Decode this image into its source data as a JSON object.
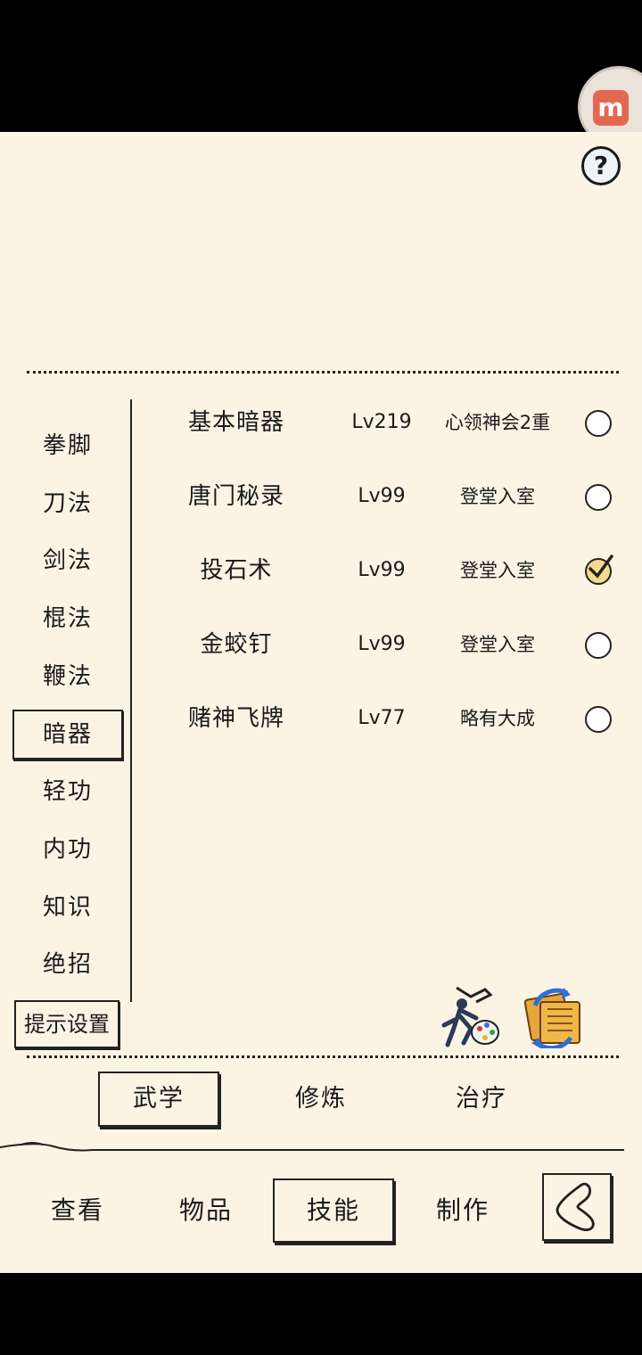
{
  "help": {
    "label": "?"
  },
  "app_badge": {
    "label": "m"
  },
  "categories": [
    "拳脚",
    "刀法",
    "剑法",
    "棍法",
    "鞭法",
    "暗器",
    "轻功",
    "内功",
    "知识",
    "绝招"
  ],
  "active_category": "暗器",
  "hint_settings_label": "提示设置",
  "skills": [
    {
      "name": "基本暗器",
      "level": "Lv219",
      "stage": "心领神会2重",
      "checked": false
    },
    {
      "name": "唐门秘录",
      "level": "Lv99",
      "stage": "登堂入室",
      "checked": false
    },
    {
      "name": "投石术",
      "level": "Lv99",
      "stage": "登堂入室",
      "checked": true
    },
    {
      "name": "金蛟钉",
      "level": "Lv99",
      "stage": "登堂入室",
      "checked": false
    },
    {
      "name": "赌神飞牌",
      "level": "Lv77",
      "stage": "略有大成",
      "checked": false
    }
  ],
  "sub_tabs": [
    "武学",
    "修炼",
    "治疗"
  ],
  "active_sub_tab": "武学",
  "nav_tabs": [
    "查看",
    "物品",
    "技能",
    "制作"
  ],
  "active_nav_tab": "技能",
  "icons": {
    "help": "question-icon",
    "skin": "warrior-palette-icon",
    "swap": "scroll-swap-icon",
    "back": "back-arrow-icon"
  }
}
